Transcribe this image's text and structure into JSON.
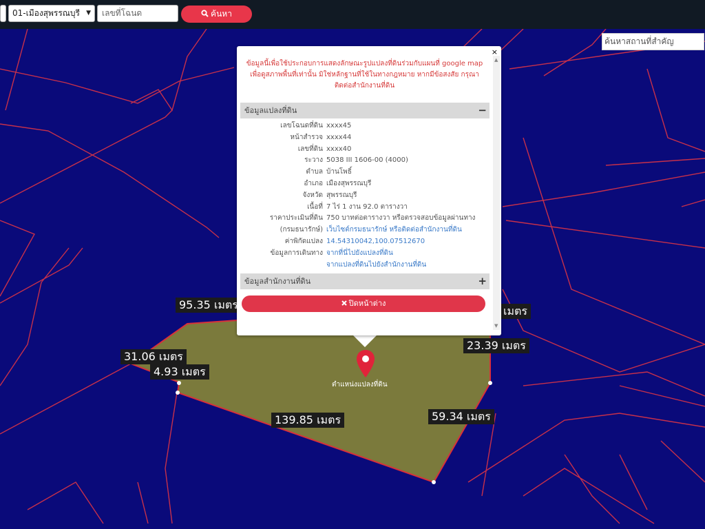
{
  "toolbar": {
    "district_select": "01-เมืองสุพรรณบุรี",
    "deed_placeholder": "เลขที่โฉนด",
    "search_label": "ค้นหา"
  },
  "poi_search": {
    "placeholder": "ค้นหาสถานที่สำคัญ"
  },
  "measurements": [
    "95.35 เมตร",
    "เมตร",
    "23.39 เมตร",
    "31.06 เมตร",
    "4.93 เมตร",
    "139.85 เมตร",
    "59.34 เมตร"
  ],
  "marker_label": "ตำแหน่งแปลงที่ดิน",
  "popup": {
    "close_glyph": "×",
    "warning": "ข้อมูลนี้เพื่อใช้ประกอบการแสดงลักษณะรูปแปลงที่ดินร่วมกับแผนที่ google map เพื่อดูสภาพพื้นที่เท่านั้น มิใช่หลักฐานที่ใช้ในทางกฎหมาย หากมีข้อสงสัย กรุณาติดต่อสำนักงานที่ดิน",
    "section_parcel": "ข้อมูลแปลงที่ดิน",
    "section_parcel_toggle": "−",
    "rows": [
      {
        "label": "เลขโฉนดที่ดิน",
        "value": "xxxx45"
      },
      {
        "label": "หน้าสำรวจ",
        "value": "xxxx44"
      },
      {
        "label": "เลขที่ดิน",
        "value": "xxxx40"
      },
      {
        "label": "ระวาง",
        "value": "5038 III 1606-00 (4000)"
      },
      {
        "label": "ตำบล",
        "value": "บ้านโพธิ์"
      },
      {
        "label": "อำเภอ",
        "value": "เมืองสุพรรณบุรี"
      },
      {
        "label": "จังหวัด",
        "value": "สุพรรณบุรี"
      },
      {
        "label": "เนื้อที่",
        "value": "7 ไร่ 1 งาน 92.0 ตารางวา"
      },
      {
        "label": "ราคาประเมินที่ดิน",
        "value": "750 บาทต่อตารางวา หรือตรวจสอบข้อมูลผ่านทาง"
      },
      {
        "label": "(กรมธนารักษ์)",
        "value": "เว็บไซต์กรมธนารักษ์ หรือติดต่อสำนักงานที่ดิน"
      },
      {
        "label": "ค่าพิกัดแปลง",
        "value": "14.54310042,100.07512670"
      },
      {
        "label": "ข้อมูลการเดินทาง",
        "value": "จากที่นี่ไปยังแปลงที่ดิน"
      },
      {
        "label": "",
        "value": "จากแปลงที่ดินไปยังสำนักงานที่ดิน"
      }
    ],
    "section_office": "ข้อมูลสำนักงานที่ดิน",
    "section_office_toggle": "+",
    "close_button": "ปิดหน้าต่าง"
  },
  "colors": {
    "map_bg": "#0a0a7a",
    "parcel_fill": "#7b7a3c",
    "boundary": "#d8303a",
    "accent": "#e8364a"
  }
}
